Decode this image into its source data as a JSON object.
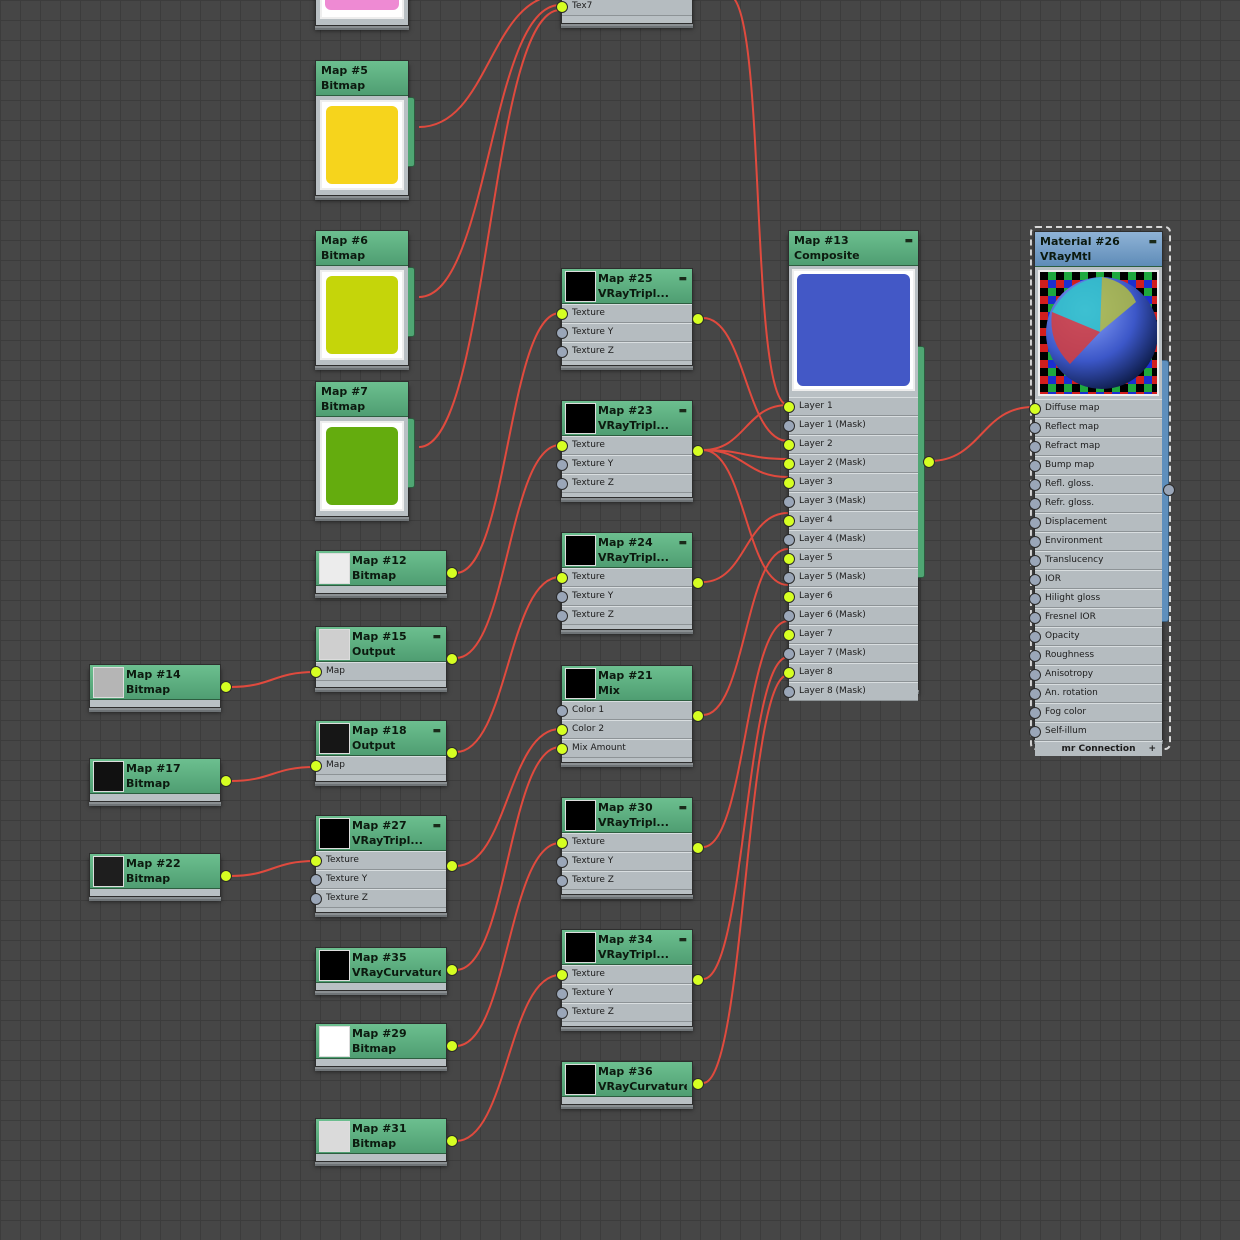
{
  "editor": "Slate Material Editor",
  "nodes": {
    "n_tex7": {
      "title": "",
      "subtitle": "Tex7",
      "slots": [
        "Tex7"
      ]
    },
    "n_pink": {
      "title": "",
      "subtitle": ""
    },
    "n5": {
      "title": "Map #5",
      "subtitle": "Bitmap",
      "color": "#f6d41c"
    },
    "n6": {
      "title": "Map #6",
      "subtitle": "Bitmap",
      "color": "#c5d50a"
    },
    "n7": {
      "title": "Map #7",
      "subtitle": "Bitmap",
      "color": "#64ac0e"
    },
    "n12": {
      "title": "Map #12",
      "subtitle": "Bitmap"
    },
    "n14": {
      "title": "Map #14",
      "subtitle": "Bitmap"
    },
    "n15": {
      "title": "Map #15",
      "subtitle": "Output",
      "slots": [
        "Map"
      ]
    },
    "n17": {
      "title": "Map #17",
      "subtitle": "Bitmap"
    },
    "n18": {
      "title": "Map #18",
      "subtitle": "Output",
      "slots": [
        "Map"
      ]
    },
    "n22": {
      "title": "Map #22",
      "subtitle": "Bitmap"
    },
    "n27": {
      "title": "Map #27",
      "subtitle": "VRayTripl...",
      "slots": [
        "Texture",
        "Texture Y",
        "Texture Z"
      ]
    },
    "n35": {
      "title": "Map #35",
      "subtitle": "VRayCurvature"
    },
    "n29": {
      "title": "Map #29",
      "subtitle": "Bitmap"
    },
    "n31": {
      "title": "Map #31",
      "subtitle": "Bitmap"
    },
    "n25": {
      "title": "Map #25",
      "subtitle": "VRayTripl...",
      "slots": [
        "Texture",
        "Texture Y",
        "Texture Z"
      ]
    },
    "n23": {
      "title": "Map #23",
      "subtitle": "VRayTripl...",
      "slots": [
        "Texture",
        "Texture Y",
        "Texture Z"
      ]
    },
    "n24": {
      "title": "Map #24",
      "subtitle": "VRayTripl...",
      "slots": [
        "Texture",
        "Texture Y",
        "Texture Z"
      ]
    },
    "n21": {
      "title": "Map #21",
      "subtitle": "Mix",
      "slots": [
        "Color 1",
        "Color 2",
        "Mix Amount"
      ]
    },
    "n30": {
      "title": "Map #30",
      "subtitle": "VRayTripl...",
      "slots": [
        "Texture",
        "Texture Y",
        "Texture Z"
      ]
    },
    "n34": {
      "title": "Map #34",
      "subtitle": "VRayTripl...",
      "slots": [
        "Texture",
        "Texture Y",
        "Texture Z"
      ]
    },
    "n36": {
      "title": "Map #36",
      "subtitle": "VRayCurvature"
    },
    "n13": {
      "title": "Map #13",
      "subtitle": "Composite",
      "color": "#4358c6",
      "slots": [
        "Layer 1",
        "Layer 1 (Mask)",
        "Layer 2",
        "Layer 2 (Mask)",
        "Layer 3",
        "Layer 3 (Mask)",
        "Layer 4",
        "Layer 4 (Mask)",
        "Layer 5",
        "Layer 5 (Mask)",
        "Layer 6",
        "Layer 6 (Mask)",
        "Layer 7",
        "Layer 7 (Mask)",
        "Layer 8",
        "Layer 8 (Mask)"
      ]
    },
    "n26": {
      "title": "Material #26",
      "subtitle": "VRayMtl",
      "slots": [
        "Diffuse map",
        "Reflect map",
        "Refract map",
        "Bump map",
        "Refl. gloss.",
        "Refr. gloss.",
        "Displacement",
        "Environment",
        "Translucency",
        "IOR",
        "Hilight gloss",
        "Fresnel IOR",
        "Opacity",
        "Roughness",
        "Anisotropy",
        "An. rotation",
        "Fog color",
        "Self-illum"
      ],
      "footer": "mr Connection"
    }
  },
  "colors": {
    "wire": "#e04a3e",
    "map_header": "#5aae7f",
    "material_header": "#6f9ac4",
    "port_connected": "#d6ff22",
    "port_empty": "#9aa6b8"
  }
}
